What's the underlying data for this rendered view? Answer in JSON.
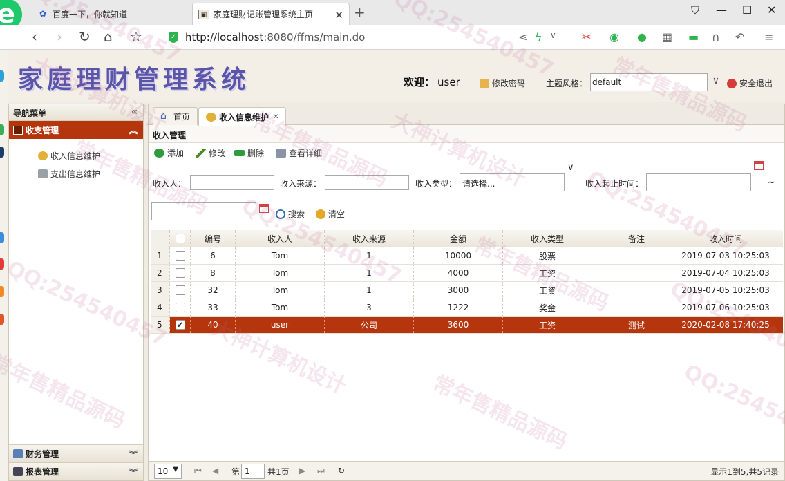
{
  "browser": {
    "tabs": [
      {
        "title": "百度一下，你就知道"
      },
      {
        "title": "家庭理财记账管理系统主页"
      }
    ],
    "url_host": "http://localhost",
    "url_rest": ":8080/ffms/main.do"
  },
  "header": {
    "system_title": "家庭理财管理系统",
    "welcome_label": "欢迎：",
    "username": "user",
    "change_password": "修改密码",
    "theme_label": "主题风格：",
    "theme_value": "default",
    "logout": "安全退出"
  },
  "sidebar": {
    "title": "导航菜单",
    "active_group": "收支管理",
    "items": [
      {
        "label": "收入信息维护"
      },
      {
        "label": "支出信息维护"
      }
    ],
    "bottom_groups": [
      {
        "label": "财务管理"
      },
      {
        "label": "报表管理"
      }
    ]
  },
  "main": {
    "tabs": [
      {
        "label": "首页"
      },
      {
        "label": "收入信息维护"
      }
    ],
    "panel_title": "收入管理",
    "toolbar": {
      "add": "添加",
      "edit": "修改",
      "delete": "删除",
      "view": "查看详细"
    },
    "filters": {
      "income_person_label": "收入人：",
      "income_source_label": "收入来源：",
      "income_type_label": "收入类型：",
      "income_type_value": "请选择...",
      "time_range_label": "收入起止时间：",
      "range_sep": "~",
      "search": "搜索",
      "clear": "清空"
    },
    "grid": {
      "columns": [
        "编号",
        "收入人",
        "收入来源",
        "金额",
        "收入类型",
        "备注",
        "收入时间"
      ],
      "rows": [
        {
          "num": "1",
          "id": "6",
          "person": "Tom",
          "source": "1",
          "amount": "10000",
          "type": "股票",
          "note": "",
          "time": "2019-07-03 10:25:03",
          "checked": false
        },
        {
          "num": "2",
          "id": "8",
          "person": "Tom",
          "source": "1",
          "amount": "4000",
          "type": "工资",
          "note": "",
          "time": "2019-07-04 10:25:03",
          "checked": false
        },
        {
          "num": "3",
          "id": "32",
          "person": "Tom",
          "source": "1",
          "amount": "3000",
          "type": "工资",
          "note": "",
          "time": "2019-07-05 10:25:03",
          "checked": false
        },
        {
          "num": "4",
          "id": "33",
          "person": "Tom",
          "source": "3",
          "amount": "1222",
          "type": "奖金",
          "note": "",
          "time": "2019-07-06 10:25:03",
          "checked": false
        },
        {
          "num": "5",
          "id": "40",
          "person": "user",
          "source": "公司",
          "amount": "3600",
          "type": "工资",
          "note": "测试",
          "time": "2020-02-08 17:40:25",
          "checked": true
        }
      ]
    },
    "pager": {
      "page_size": "10",
      "page_prefix": "第",
      "page_value": "1",
      "page_total": "共1页",
      "summary": "显示1到5,共5记录"
    }
  },
  "watermarks": [
    "QQ:254540457",
    "大神计算机设计",
    "常年售精品源码"
  ],
  "colors": {
    "accent": "#b5360d",
    "title": "#5a55a8"
  }
}
